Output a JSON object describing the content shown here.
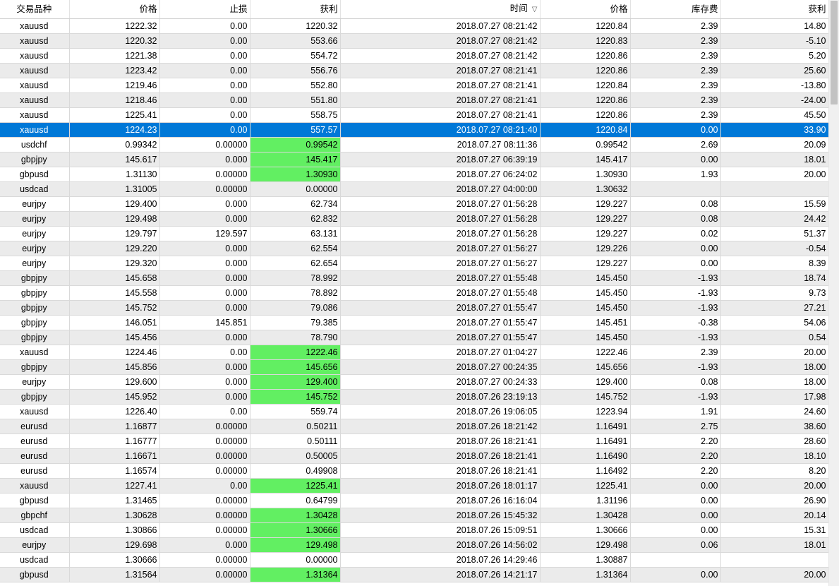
{
  "headers": {
    "symbol": "交易品种",
    "price": "价格",
    "stop_loss": "止损",
    "take_profit": "获利",
    "time": "时间",
    "price2": "价格",
    "swap": "库存费",
    "profit": "获利"
  },
  "sort_icon": "▽",
  "selected_row": 7,
  "rows": [
    {
      "symbol": "xauusd",
      "price": "1222.32",
      "sl": "0.00",
      "tp": "1220.32",
      "time": "2018.07.27 08:21:42",
      "price2": "1220.84",
      "swap": "2.39",
      "profit": "14.80",
      "hl": false
    },
    {
      "symbol": "xauusd",
      "price": "1220.32",
      "sl": "0.00",
      "tp": "553.66",
      "time": "2018.07.27 08:21:42",
      "price2": "1220.83",
      "swap": "2.39",
      "profit": "-5.10",
      "hl": false
    },
    {
      "symbol": "xauusd",
      "price": "1221.38",
      "sl": "0.00",
      "tp": "554.72",
      "time": "2018.07.27 08:21:42",
      "price2": "1220.86",
      "swap": "2.39",
      "profit": "5.20",
      "hl": false
    },
    {
      "symbol": "xauusd",
      "price": "1223.42",
      "sl": "0.00",
      "tp": "556.76",
      "time": "2018.07.27 08:21:41",
      "price2": "1220.86",
      "swap": "2.39",
      "profit": "25.60",
      "hl": false
    },
    {
      "symbol": "xauusd",
      "price": "1219.46",
      "sl": "0.00",
      "tp": "552.80",
      "time": "2018.07.27 08:21:41",
      "price2": "1220.84",
      "swap": "2.39",
      "profit": "-13.80",
      "hl": false
    },
    {
      "symbol": "xauusd",
      "price": "1218.46",
      "sl": "0.00",
      "tp": "551.80",
      "time": "2018.07.27 08:21:41",
      "price2": "1220.86",
      "swap": "2.39",
      "profit": "-24.00",
      "hl": false
    },
    {
      "symbol": "xauusd",
      "price": "1225.41",
      "sl": "0.00",
      "tp": "558.75",
      "time": "2018.07.27 08:21:41",
      "price2": "1220.86",
      "swap": "2.39",
      "profit": "45.50",
      "hl": false
    },
    {
      "symbol": "xauusd",
      "price": "1224.23",
      "sl": "0.00",
      "tp": "557.57",
      "time": "2018.07.27 08:21:40",
      "price2": "1220.84",
      "swap": "0.00",
      "profit": "33.90",
      "hl": false
    },
    {
      "symbol": "usdchf",
      "price": "0.99342",
      "sl": "0.00000",
      "tp": "0.99542",
      "time": "2018.07.27 08:11:36",
      "price2": "0.99542",
      "swap": "2.69",
      "profit": "20.09",
      "hl": true
    },
    {
      "symbol": "gbpjpy",
      "price": "145.617",
      "sl": "0.000",
      "tp": "145.417",
      "time": "2018.07.27 06:39:19",
      "price2": "145.417",
      "swap": "0.00",
      "profit": "18.01",
      "hl": true
    },
    {
      "symbol": "gbpusd",
      "price": "1.31130",
      "sl": "0.00000",
      "tp": "1.30930",
      "time": "2018.07.27 06:24:02",
      "price2": "1.30930",
      "swap": "1.93",
      "profit": "20.00",
      "hl": true
    },
    {
      "symbol": "usdcad",
      "price": "1.31005",
      "sl": "0.00000",
      "tp": "0.00000",
      "time": "2018.07.27 04:00:00",
      "price2": "1.30632",
      "swap": "",
      "profit": "",
      "hl": false
    },
    {
      "symbol": "eurjpy",
      "price": "129.400",
      "sl": "0.000",
      "tp": "62.734",
      "time": "2018.07.27 01:56:28",
      "price2": "129.227",
      "swap": "0.08",
      "profit": "15.59",
      "hl": false
    },
    {
      "symbol": "eurjpy",
      "price": "129.498",
      "sl": "0.000",
      "tp": "62.832",
      "time": "2018.07.27 01:56:28",
      "price2": "129.227",
      "swap": "0.08",
      "profit": "24.42",
      "hl": false
    },
    {
      "symbol": "eurjpy",
      "price": "129.797",
      "sl": "129.597",
      "tp": "63.131",
      "time": "2018.07.27 01:56:28",
      "price2": "129.227",
      "swap": "0.02",
      "profit": "51.37",
      "hl": false
    },
    {
      "symbol": "eurjpy",
      "price": "129.220",
      "sl": "0.000",
      "tp": "62.554",
      "time": "2018.07.27 01:56:27",
      "price2": "129.226",
      "swap": "0.00",
      "profit": "-0.54",
      "hl": false
    },
    {
      "symbol": "eurjpy",
      "price": "129.320",
      "sl": "0.000",
      "tp": "62.654",
      "time": "2018.07.27 01:56:27",
      "price2": "129.227",
      "swap": "0.00",
      "profit": "8.39",
      "hl": false
    },
    {
      "symbol": "gbpjpy",
      "price": "145.658",
      "sl": "0.000",
      "tp": "78.992",
      "time": "2018.07.27 01:55:48",
      "price2": "145.450",
      "swap": "-1.93",
      "profit": "18.74",
      "hl": false
    },
    {
      "symbol": "gbpjpy",
      "price": "145.558",
      "sl": "0.000",
      "tp": "78.892",
      "time": "2018.07.27 01:55:48",
      "price2": "145.450",
      "swap": "-1.93",
      "profit": "9.73",
      "hl": false
    },
    {
      "symbol": "gbpjpy",
      "price": "145.752",
      "sl": "0.000",
      "tp": "79.086",
      "time": "2018.07.27 01:55:47",
      "price2": "145.450",
      "swap": "-1.93",
      "profit": "27.21",
      "hl": false
    },
    {
      "symbol": "gbpjpy",
      "price": "146.051",
      "sl": "145.851",
      "tp": "79.385",
      "time": "2018.07.27 01:55:47",
      "price2": "145.451",
      "swap": "-0.38",
      "profit": "54.06",
      "hl": false
    },
    {
      "symbol": "gbpjpy",
      "price": "145.456",
      "sl": "0.000",
      "tp": "78.790",
      "time": "2018.07.27 01:55:47",
      "price2": "145.450",
      "swap": "-1.93",
      "profit": "0.54",
      "hl": false
    },
    {
      "symbol": "xauusd",
      "price": "1224.46",
      "sl": "0.00",
      "tp": "1222.46",
      "time": "2018.07.27 01:04:27",
      "price2": "1222.46",
      "swap": "2.39",
      "profit": "20.00",
      "hl": true
    },
    {
      "symbol": "gbpjpy",
      "price": "145.856",
      "sl": "0.000",
      "tp": "145.656",
      "time": "2018.07.27 00:24:35",
      "price2": "145.656",
      "swap": "-1.93",
      "profit": "18.00",
      "hl": true
    },
    {
      "symbol": "eurjpy",
      "price": "129.600",
      "sl": "0.000",
      "tp": "129.400",
      "time": "2018.07.27 00:24:33",
      "price2": "129.400",
      "swap": "0.08",
      "profit": "18.00",
      "hl": true
    },
    {
      "symbol": "gbpjpy",
      "price": "145.952",
      "sl": "0.000",
      "tp": "145.752",
      "time": "2018.07.26 23:19:13",
      "price2": "145.752",
      "swap": "-1.93",
      "profit": "17.98",
      "hl": true
    },
    {
      "symbol": "xauusd",
      "price": "1226.40",
      "sl": "0.00",
      "tp": "559.74",
      "time": "2018.07.26 19:06:05",
      "price2": "1223.94",
      "swap": "1.91",
      "profit": "24.60",
      "hl": false
    },
    {
      "symbol": "eurusd",
      "price": "1.16877",
      "sl": "0.00000",
      "tp": "0.50211",
      "time": "2018.07.26 18:21:42",
      "price2": "1.16491",
      "swap": "2.75",
      "profit": "38.60",
      "hl": false
    },
    {
      "symbol": "eurusd",
      "price": "1.16777",
      "sl": "0.00000",
      "tp": "0.50111",
      "time": "2018.07.26 18:21:41",
      "price2": "1.16491",
      "swap": "2.20",
      "profit": "28.60",
      "hl": false
    },
    {
      "symbol": "eurusd",
      "price": "1.16671",
      "sl": "0.00000",
      "tp": "0.50005",
      "time": "2018.07.26 18:21:41",
      "price2": "1.16490",
      "swap": "2.20",
      "profit": "18.10",
      "hl": false
    },
    {
      "symbol": "eurusd",
      "price": "1.16574",
      "sl": "0.00000",
      "tp": "0.49908",
      "time": "2018.07.26 18:21:41",
      "price2": "1.16492",
      "swap": "2.20",
      "profit": "8.20",
      "hl": false
    },
    {
      "symbol": "xauusd",
      "price": "1227.41",
      "sl": "0.00",
      "tp": "1225.41",
      "time": "2018.07.26 18:01:17",
      "price2": "1225.41",
      "swap": "0.00",
      "profit": "20.00",
      "hl": true
    },
    {
      "symbol": "gbpusd",
      "price": "1.31465",
      "sl": "0.00000",
      "tp": "0.64799",
      "time": "2018.07.26 16:16:04",
      "price2": "1.31196",
      "swap": "0.00",
      "profit": "26.90",
      "hl": false
    },
    {
      "symbol": "gbpchf",
      "price": "1.30628",
      "sl": "0.00000",
      "tp": "1.30428",
      "time": "2018.07.26 15:45:32",
      "price2": "1.30428",
      "swap": "0.00",
      "profit": "20.14",
      "hl": true
    },
    {
      "symbol": "usdcad",
      "price": "1.30866",
      "sl": "0.00000",
      "tp": "1.30666",
      "time": "2018.07.26 15:09:51",
      "price2": "1.30666",
      "swap": "0.00",
      "profit": "15.31",
      "hl": true
    },
    {
      "symbol": "eurjpy",
      "price": "129.698",
      "sl": "0.000",
      "tp": "129.498",
      "time": "2018.07.26 14:56:02",
      "price2": "129.498",
      "swap": "0.06",
      "profit": "18.01",
      "hl": true
    },
    {
      "symbol": "usdcad",
      "price": "1.30666",
      "sl": "0.00000",
      "tp": "0.00000",
      "time": "2018.07.26 14:29:46",
      "price2": "1.30887",
      "swap": "",
      "profit": "",
      "hl": false
    },
    {
      "symbol": "gbpusd",
      "price": "1.31564",
      "sl": "0.00000",
      "tp": "1.31364",
      "time": "2018.07.26 14:21:17",
      "price2": "1.31364",
      "swap": "0.00",
      "profit": "20.00",
      "hl": true
    }
  ],
  "colors": {
    "selected_row": "#0078d7",
    "take_profit_hit": "#62ef62",
    "alt_row": "#ebebeb"
  }
}
